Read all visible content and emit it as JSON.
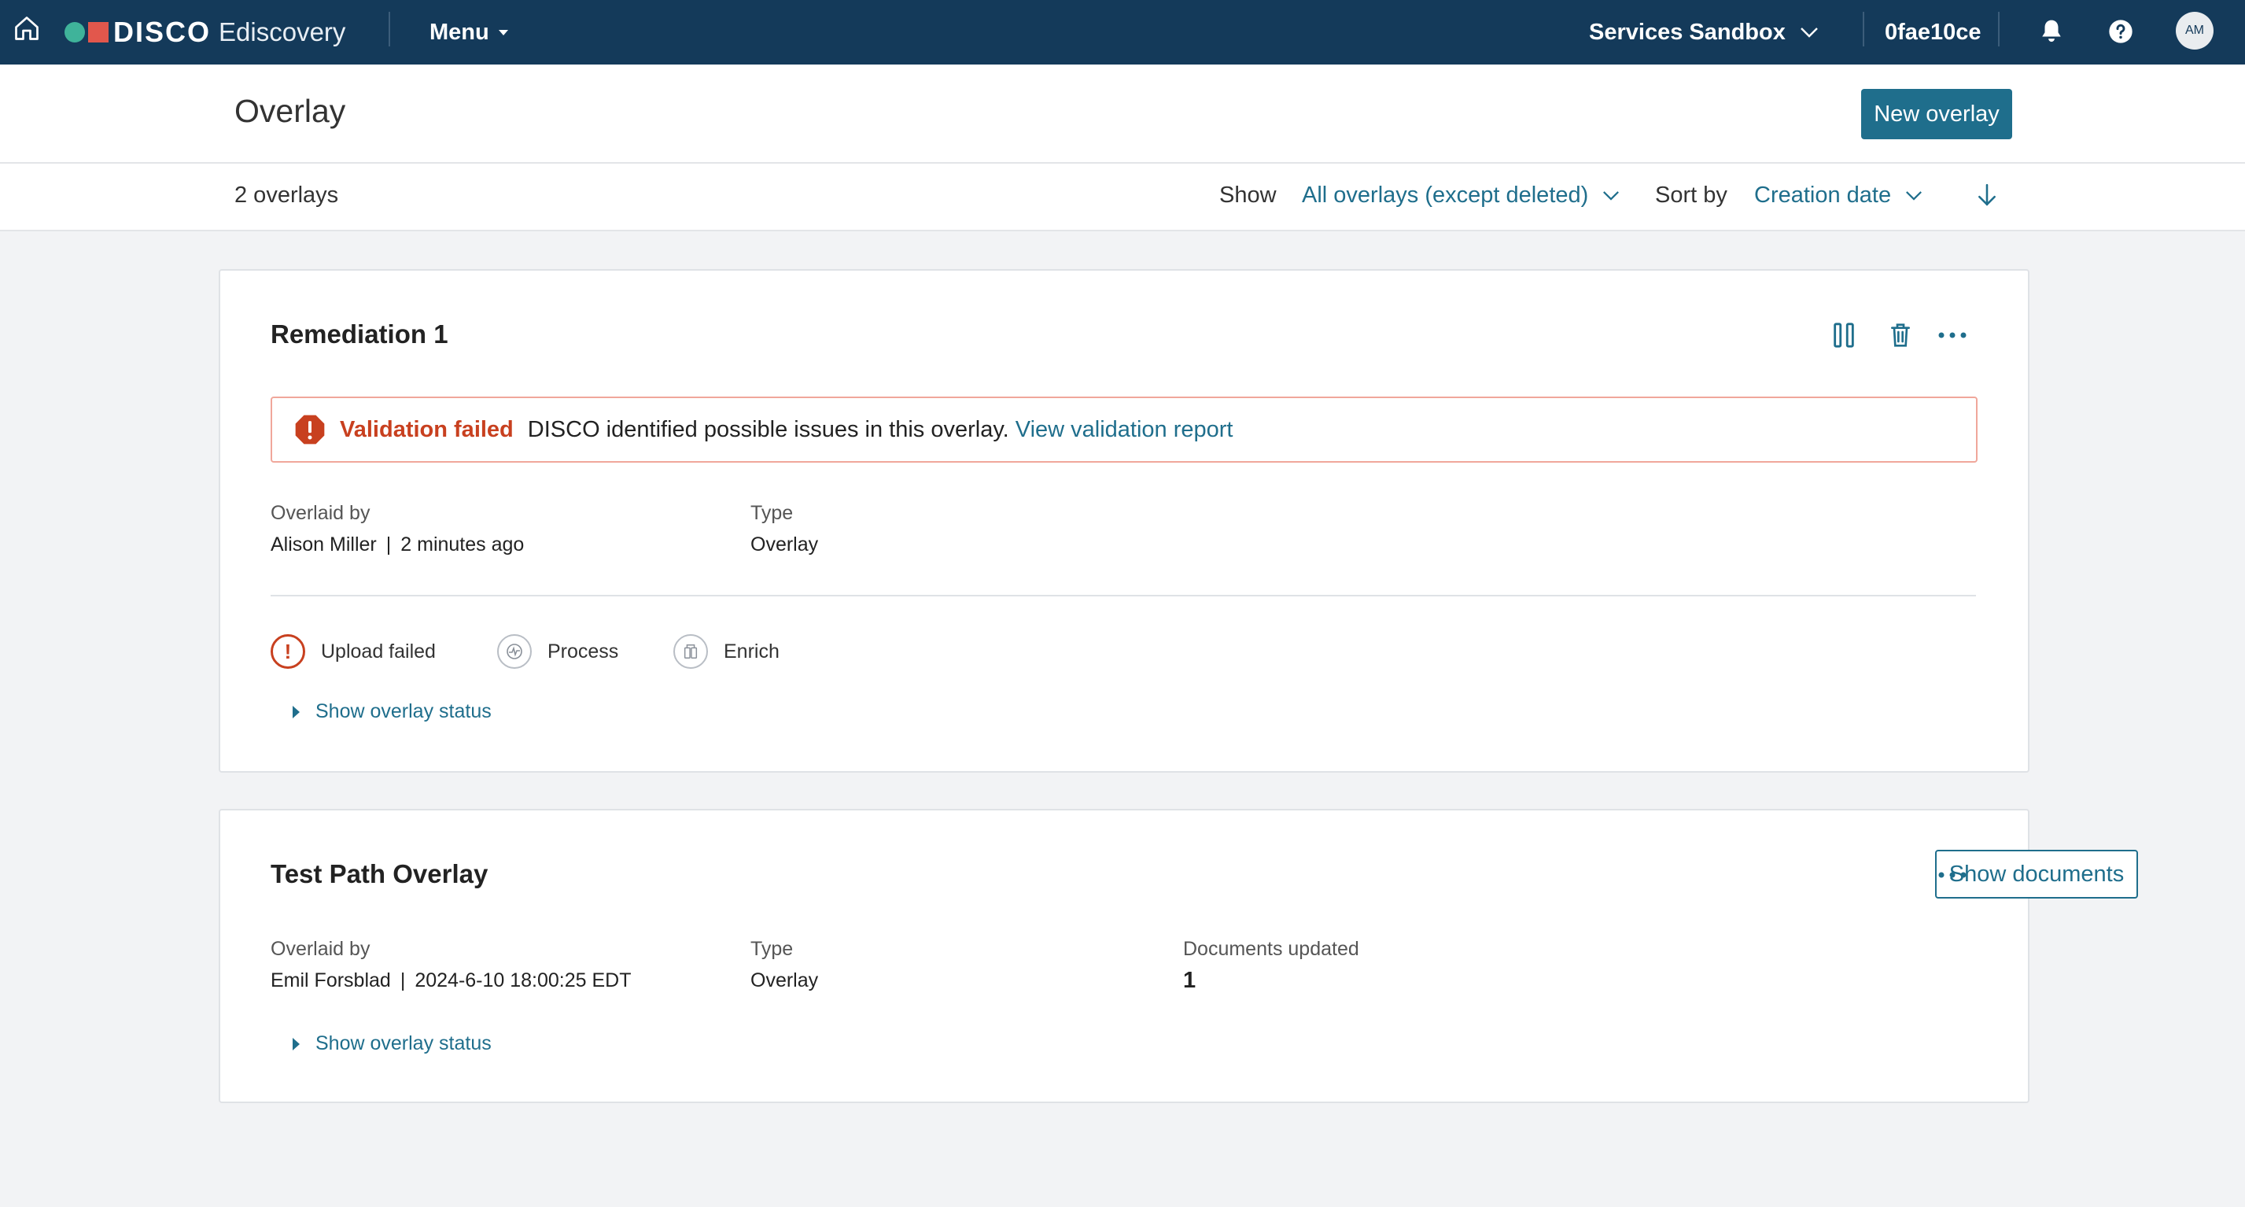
{
  "nav": {
    "brand": "DISCO",
    "product": "Ediscovery",
    "menu_label": "Menu",
    "workspace": "Services Sandbox",
    "case_id": "0fae10ce",
    "avatar_initials": "AM",
    "colors": {
      "nav_bg": "#143a5a",
      "logo_dot": "#3fb39a",
      "logo_square": "#e2574c"
    }
  },
  "page": {
    "title": "Overlay",
    "new_button": "New overlay",
    "accent": "#1f6e8c"
  },
  "filters": {
    "count": "2 overlays",
    "show_label": "Show",
    "show_value": "All overlays (except deleted)",
    "sort_label": "Sort by",
    "sort_value": "Creation date"
  },
  "overlays": [
    {
      "name": "Remediation 1",
      "alert": {
        "title": "Validation failed",
        "message": "DISCO identified possible issues in this overlay.",
        "link": "View validation report",
        "color": "#c8401f"
      },
      "overlaid_by_label": "Overlaid by",
      "overlaid_by": "Alison Miller",
      "when": "2 minutes ago",
      "type_label": "Type",
      "type": "Overlay",
      "steps": [
        {
          "label": "Upload failed",
          "icon": "error-icon"
        },
        {
          "label": "Process",
          "icon": "process-icon"
        },
        {
          "label": "Enrich",
          "icon": "enrich-icon"
        }
      ],
      "status_toggle": "Show overlay status"
    },
    {
      "name": "Test Path Overlay",
      "show_docs_button": "Show documents",
      "overlaid_by_label": "Overlaid by",
      "overlaid_by": "Emil Forsblad",
      "when": "2024-6-10 18:00:25 EDT",
      "type_label": "Type",
      "type": "Overlay",
      "docs_label": "Documents updated",
      "docs_value": "1",
      "status_toggle": "Show overlay status"
    }
  ]
}
